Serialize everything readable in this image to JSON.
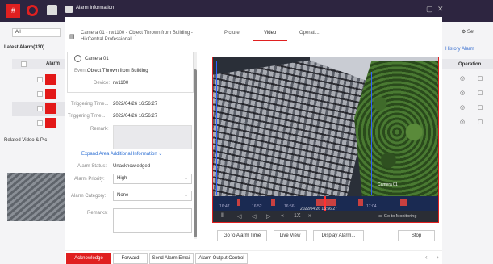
{
  "dialog": {
    "title": "Alarm Information",
    "header": "Camera 01 - rw1100 - Object Thrown from Building - HikCentral Professional",
    "camera_name": "Camera 01",
    "event_label": "Event:",
    "event_value": "Object Thrown from Building",
    "device_label": "Device:",
    "device_value": "rw1100",
    "triggering_time_label_1": "Triggering Time...",
    "triggering_time_value_1": "2022/04/26 16:56:27",
    "triggering_time_label_2": "Triggering Time...",
    "triggering_time_value_2": "2022/04/26 16:56:27",
    "remark_label": "Remark:",
    "expand_label": "Expand Area Additional Information",
    "alarm_status_label": "Alarm Status:",
    "alarm_status_value": "Unacknowledged",
    "alarm_priority_label": "Alarm Priority:",
    "alarm_priority_value": "High",
    "alarm_category_label": "Alarm Category:",
    "alarm_category_value": "None",
    "remarks_label": "Remarks:"
  },
  "tabs": [
    "Picture",
    "Video",
    "Operati..."
  ],
  "active_tab": "Video",
  "video": {
    "camera_overlay": "Camera 01",
    "time_overlay": "2022/04/26 16:56:27",
    "ticks": [
      "16:47",
      "16:52",
      "16:56",
      "17:04"
    ],
    "grid_monitoring": "Go to Monitoring"
  },
  "action_buttons": [
    "Go to Alarm Time",
    "Live View",
    "Display Alarm...",
    "Stop"
  ],
  "footer": {
    "acknowledge": "Acknowledge",
    "forward": "Forward",
    "send_email": "Send Alarm Email",
    "alarm_output": "Alarm Output Control"
  },
  "background": {
    "filter_value": "All",
    "latest_alarm": "Latest Alarm(330)",
    "alarm_column": "Alarm",
    "related_video": "Related Video & Pic",
    "settings": "Set",
    "history_alarm": "History Alarm",
    "operation_column": "Operation"
  },
  "colors": {
    "accent": "#e02020",
    "link": "#2d6fd3",
    "background_purple": "#4b3a78"
  }
}
